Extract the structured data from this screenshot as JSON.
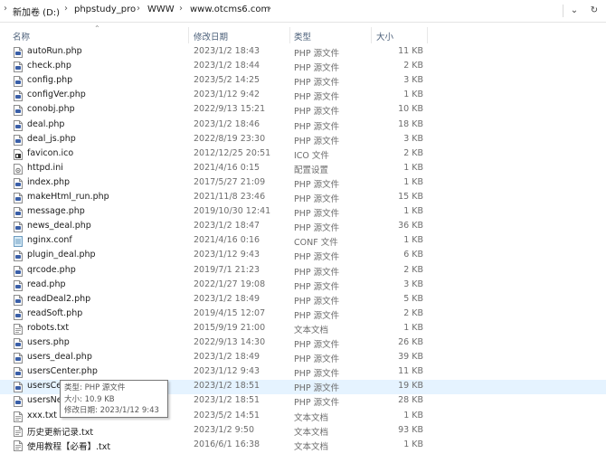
{
  "breadcrumb": {
    "segments": [
      "新加卷 (D:)",
      "phpstudy_pro",
      "WWW",
      "www.otcms6.com"
    ],
    "separator": "›"
  },
  "controls": {
    "dropdown_glyph": "⌄",
    "refresh_glyph": "↻"
  },
  "columns": {
    "name": "名称",
    "date": "修改日期",
    "type": "类型",
    "size": "大小",
    "sort_glyph": "⌃"
  },
  "files": [
    {
      "name": "autoRun.php",
      "date": "2023/1/2 18:43",
      "type": "PHP 源文件",
      "size": "11 KB",
      "icon": "php"
    },
    {
      "name": "check.php",
      "date": "2023/1/2 18:44",
      "type": "PHP 源文件",
      "size": "2 KB",
      "icon": "php"
    },
    {
      "name": "config.php",
      "date": "2023/5/2 14:25",
      "type": "PHP 源文件",
      "size": "3 KB",
      "icon": "php"
    },
    {
      "name": "configVer.php",
      "date": "2023/1/12 9:42",
      "type": "PHP 源文件",
      "size": "1 KB",
      "icon": "php"
    },
    {
      "name": "conobj.php",
      "date": "2022/9/13 15:21",
      "type": "PHP 源文件",
      "size": "10 KB",
      "icon": "php"
    },
    {
      "name": "deal.php",
      "date": "2023/1/2 18:46",
      "type": "PHP 源文件",
      "size": "18 KB",
      "icon": "php"
    },
    {
      "name": "deal_js.php",
      "date": "2022/8/19 23:30",
      "type": "PHP 源文件",
      "size": "3 KB",
      "icon": "php"
    },
    {
      "name": "favicon.ico",
      "date": "2012/12/25 20:51",
      "type": "ICO 文件",
      "size": "2 KB",
      "icon": "ico"
    },
    {
      "name": "httpd.ini",
      "date": "2021/4/16 0:15",
      "type": "配置设置",
      "size": "1 KB",
      "icon": "ini"
    },
    {
      "name": "index.php",
      "date": "2017/5/27 21:09",
      "type": "PHP 源文件",
      "size": "1 KB",
      "icon": "php"
    },
    {
      "name": "makeHtml_run.php",
      "date": "2021/11/8 23:46",
      "type": "PHP 源文件",
      "size": "15 KB",
      "icon": "php"
    },
    {
      "name": "message.php",
      "date": "2019/10/30 12:41",
      "type": "PHP 源文件",
      "size": "1 KB",
      "icon": "php"
    },
    {
      "name": "news_deal.php",
      "date": "2023/1/2 18:47",
      "type": "PHP 源文件",
      "size": "36 KB",
      "icon": "php"
    },
    {
      "name": "nginx.conf",
      "date": "2021/4/16 0:16",
      "type": "CONF 文件",
      "size": "1 KB",
      "icon": "conf"
    },
    {
      "name": "plugin_deal.php",
      "date": "2023/1/12 9:43",
      "type": "PHP 源文件",
      "size": "6 KB",
      "icon": "php"
    },
    {
      "name": "qrcode.php",
      "date": "2019/7/1 21:23",
      "type": "PHP 源文件",
      "size": "2 KB",
      "icon": "php"
    },
    {
      "name": "read.php",
      "date": "2022/1/27 19:08",
      "type": "PHP 源文件",
      "size": "3 KB",
      "icon": "php"
    },
    {
      "name": "readDeal2.php",
      "date": "2023/1/2 18:49",
      "type": "PHP 源文件",
      "size": "5 KB",
      "icon": "php"
    },
    {
      "name": "readSoft.php",
      "date": "2019/4/15 12:07",
      "type": "PHP 源文件",
      "size": "2 KB",
      "icon": "php"
    },
    {
      "name": "robots.txt",
      "date": "2015/9/19 21:00",
      "type": "文本文档",
      "size": "1 KB",
      "icon": "txt"
    },
    {
      "name": "users.php",
      "date": "2022/9/13 14:30",
      "type": "PHP 源文件",
      "size": "26 KB",
      "icon": "php"
    },
    {
      "name": "users_deal.php",
      "date": "2023/1/2 18:49",
      "type": "PHP 源文件",
      "size": "39 KB",
      "icon": "php"
    },
    {
      "name": "usersCenter.php",
      "date": "2023/1/12 9:43",
      "type": "PHP 源文件",
      "size": "11 KB",
      "icon": "php"
    },
    {
      "name": "usersCer",
      "date": "2023/1/2 18:51",
      "type": "PHP 源文件",
      "size": "19 KB",
      "icon": "php"
    },
    {
      "name": "usersNe",
      "date": "2023/1/2 18:51",
      "type": "PHP 源文件",
      "size": "28 KB",
      "icon": "php"
    },
    {
      "name": "xxx.txt",
      "date": "2023/5/2 14:51",
      "type": "文本文档",
      "size": "1 KB",
      "icon": "txt"
    },
    {
      "name": "历史更新记录.txt",
      "date": "2023/1/2 9:50",
      "type": "文本文档",
      "size": "93 KB",
      "icon": "txt"
    },
    {
      "name": "使用教程【必看】.txt",
      "date": "2016/6/1 16:38",
      "type": "文本文档",
      "size": "1 KB",
      "icon": "txt"
    }
  ],
  "selected_index": 23,
  "tooltip": {
    "type_line": "类型: PHP 源文件",
    "size_line": "大小: 10.9 KB",
    "date_line": "修改日期: 2023/1/12 9:43"
  },
  "colors": {
    "selected_bg": "#e5f3ff",
    "header_text": "#4c607a",
    "php_icon": "#3a5fa8"
  }
}
